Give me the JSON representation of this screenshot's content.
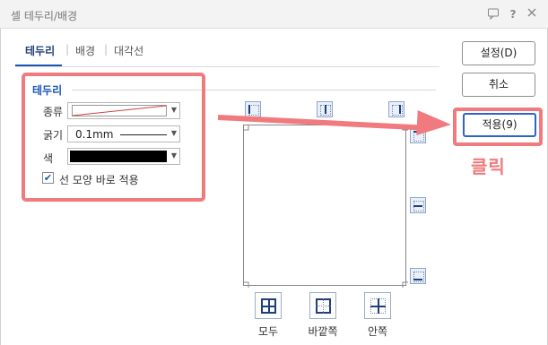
{
  "window": {
    "title": "셀 테두리/배경",
    "icons": [
      "chat-icon",
      "help-icon",
      "close-icon"
    ]
  },
  "tabs": [
    {
      "label": "테두리",
      "active": true
    },
    {
      "label": "배경",
      "active": false
    },
    {
      "label": "대각선",
      "active": false
    }
  ],
  "border_group": {
    "title": "테두리",
    "type_label": "종류",
    "thickness_label": "굵기",
    "thickness_value": "0.1mm",
    "color_label": "색",
    "color_value": "#000000",
    "apply_checkbox_label": "선 모양 바로 적용",
    "apply_checkbox_checked": true
  },
  "preset_buttons": [
    {
      "label": "모두",
      "icon": "all-borders-icon"
    },
    {
      "label": "바깥쪽",
      "icon": "outer-borders-icon"
    },
    {
      "label": "안쪽",
      "icon": "inner-borders-icon"
    }
  ],
  "side_buttons": {
    "settings": "설정(D)",
    "cancel": "취소",
    "apply": "적용(9)"
  },
  "annotation": {
    "callout_text": "클릭",
    "highlight_color": "#f07a7d"
  },
  "colors": {
    "accent": "#1a56b3",
    "annotation": "#f07a7d"
  }
}
